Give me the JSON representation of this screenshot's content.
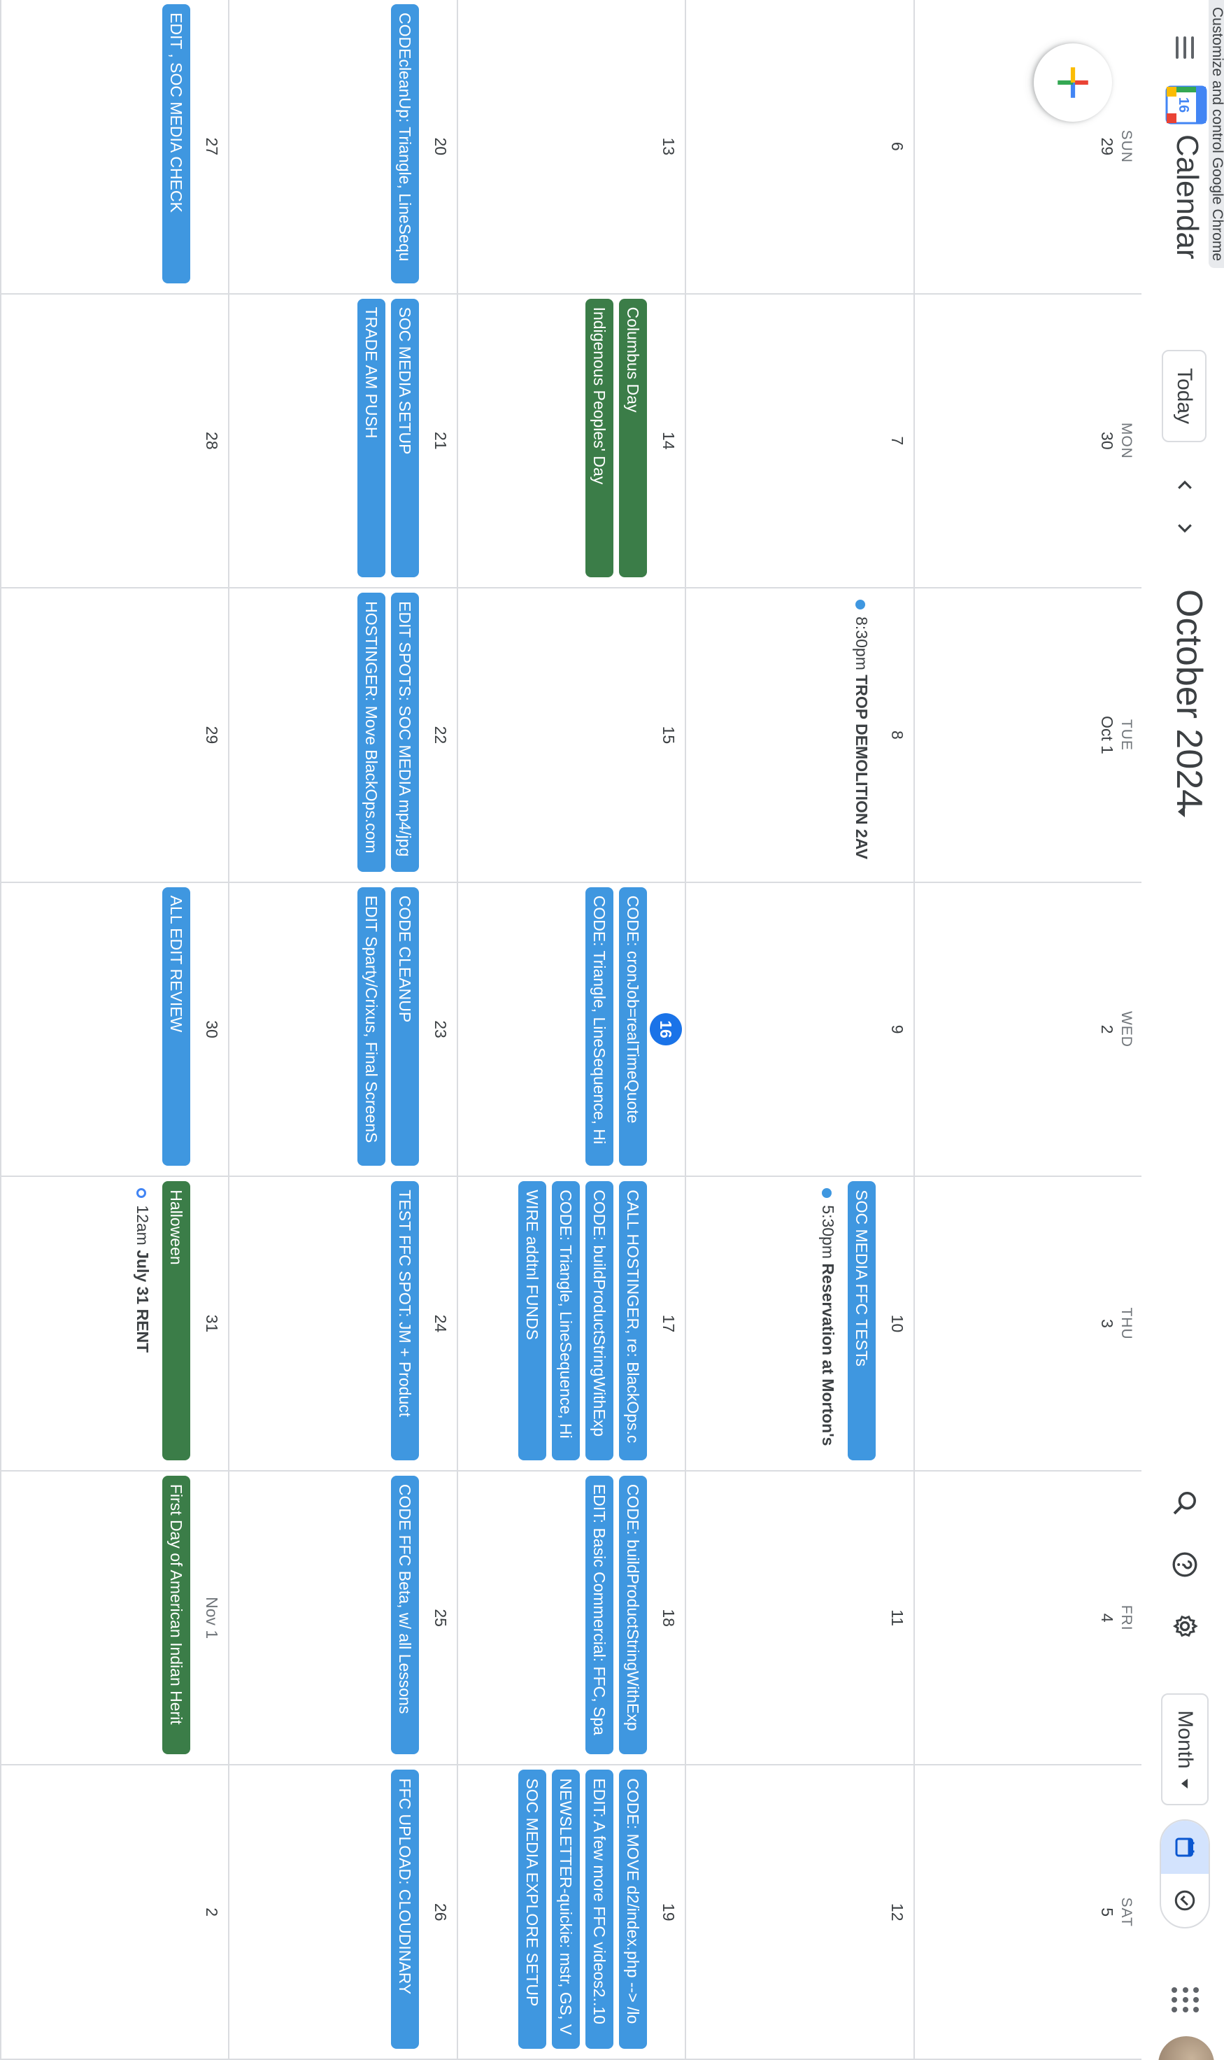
{
  "header": {
    "tooltip": "Customize and control Google Chrome",
    "logo_day": "16",
    "app_name": "Calendar",
    "today_label": "Today",
    "month_title": "October 2024",
    "view_label": "Month"
  },
  "colors": {
    "blue": "#3f97e0",
    "green": "#3b7d48",
    "today": "#1a73e8"
  },
  "weeks": [
    {
      "days": [
        {
          "dow": "SUN",
          "num": "29",
          "events": []
        },
        {
          "dow": "MON",
          "num": "30",
          "events": []
        },
        {
          "dow": "TUE",
          "num": "Oct 1",
          "events": []
        },
        {
          "dow": "WED",
          "num": "2",
          "events": []
        },
        {
          "dow": "THU",
          "num": "3",
          "events": []
        },
        {
          "dow": "FRI",
          "num": "4",
          "events": []
        },
        {
          "dow": "SAT",
          "num": "5",
          "events": []
        }
      ]
    },
    {
      "days": [
        {
          "num": "6",
          "events": []
        },
        {
          "num": "7",
          "events": []
        },
        {
          "num": "8",
          "events": [
            {
              "type": "timed",
              "time": "8:30pm",
              "title": "TROP DEMOLITION 2AV"
            }
          ]
        },
        {
          "num": "9",
          "events": []
        },
        {
          "num": "10",
          "events": [
            {
              "type": "allday",
              "color": "blue",
              "title": "SOC MEDIA FFC TESTs"
            },
            {
              "type": "timed",
              "time": "5:30pm",
              "title": "Reservation at Morton's"
            }
          ]
        },
        {
          "num": "11",
          "events": []
        },
        {
          "num": "12",
          "events": []
        }
      ]
    },
    {
      "days": [
        {
          "num": "13",
          "events": []
        },
        {
          "num": "14",
          "events": [
            {
              "type": "allday",
              "color": "green",
              "title": "Columbus Day"
            },
            {
              "type": "allday",
              "color": "green",
              "title": "Indigenous Peoples' Day"
            }
          ]
        },
        {
          "num": "15",
          "events": []
        },
        {
          "num": "16",
          "today": true,
          "events": [
            {
              "type": "allday",
              "color": "blue",
              "title": "CODE: cronJob=realTimeQuote"
            },
            {
              "type": "allday",
              "color": "blue",
              "title": "CODE: Triangle, LineSequence, Hi"
            }
          ]
        },
        {
          "num": "17",
          "events": [
            {
              "type": "allday",
              "color": "blue",
              "title": "CALL HOSTINGER, re: BlackOps.c"
            },
            {
              "type": "allday",
              "color": "blue",
              "title": "CODE: buildProductStringWithExp"
            },
            {
              "type": "allday",
              "color": "blue",
              "title": "CODE: Triangle, LineSequence, Hi"
            },
            {
              "type": "allday",
              "color": "blue",
              "title": "WIRE addtnl FUNDS"
            }
          ]
        },
        {
          "num": "18",
          "events": [
            {
              "type": "allday",
              "color": "blue",
              "title": "CODE: buildProductStringWithExp"
            },
            {
              "type": "allday",
              "color": "blue",
              "title": "EDIT: Basic Commercial: FFC, Spa"
            }
          ]
        },
        {
          "num": "19",
          "events": [
            {
              "type": "allday",
              "color": "blue",
              "title": "CODE: MOVE d2/index.php --> /lo"
            },
            {
              "type": "allday",
              "color": "blue",
              "title": "EDIT: A few more FFC videos2..10"
            },
            {
              "type": "allday",
              "color": "blue",
              "title": "NEWSLETTER-quickie: mstr, GS, V"
            },
            {
              "type": "allday",
              "color": "blue",
              "title": "SOC MEDIA EXPLORE SETUP"
            }
          ]
        }
      ]
    },
    {
      "days": [
        {
          "num": "20",
          "events": [
            {
              "type": "allday",
              "color": "blue",
              "title": "CODEcleanUp: Triangle, LineSequ"
            }
          ]
        },
        {
          "num": "21",
          "events": [
            {
              "type": "allday",
              "color": "blue",
              "title": "SOC MEDIA SETUP"
            },
            {
              "type": "allday",
              "color": "blue",
              "title": "TRADE AM PUSH"
            }
          ]
        },
        {
          "num": "22",
          "events": [
            {
              "type": "allday",
              "color": "blue",
              "title": "EDIT SPOTS: SOC MEDIA mp4/jpg"
            },
            {
              "type": "allday",
              "color": "blue",
              "title": "HOSTINGER: Move BlackOps.com"
            }
          ]
        },
        {
          "num": "23",
          "events": [
            {
              "type": "allday",
              "color": "blue",
              "title": "CODE CLEANUP"
            },
            {
              "type": "allday",
              "color": "blue",
              "title": "EDIT Sparty/Crixus, Final ScreenS"
            }
          ]
        },
        {
          "num": "24",
          "events": [
            {
              "type": "allday",
              "color": "blue",
              "title": "TEST FFC SPOT: JM + Product"
            }
          ]
        },
        {
          "num": "25",
          "events": [
            {
              "type": "allday",
              "color": "blue",
              "title": "CODE FFC Beta, w/ all Lessons"
            }
          ]
        },
        {
          "num": "26",
          "events": [
            {
              "type": "allday",
              "color": "blue",
              "title": "FFC UPLOAD: CLOUDINARY"
            }
          ]
        }
      ]
    },
    {
      "days": [
        {
          "num": "27",
          "events": [
            {
              "type": "allday",
              "color": "blue",
              "title": "EDIT , SOC MEDIA CHECK"
            }
          ]
        },
        {
          "num": "28",
          "events": []
        },
        {
          "num": "29",
          "events": []
        },
        {
          "num": "30",
          "events": [
            {
              "type": "allday",
              "color": "blue",
              "title": "ALL EDIT REVIEW"
            }
          ]
        },
        {
          "num": "31",
          "events": [
            {
              "type": "allday",
              "color": "green",
              "title": "Halloween"
            },
            {
              "type": "timed",
              "hollow": true,
              "time": "12am",
              "title": "July 31 RENT"
            }
          ]
        },
        {
          "num": "Nov 1",
          "muted": true,
          "events": [
            {
              "type": "allday",
              "color": "green",
              "title": "First Day of American Indian Herit"
            }
          ]
        },
        {
          "num": "2",
          "events": []
        }
      ]
    }
  ]
}
